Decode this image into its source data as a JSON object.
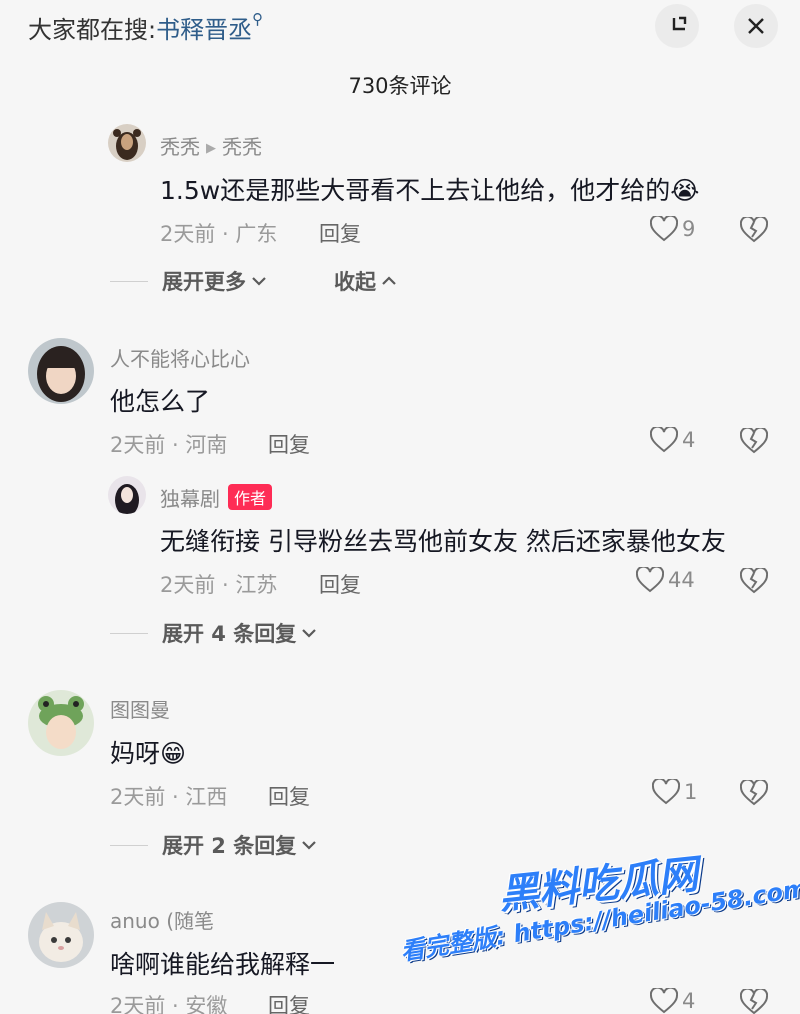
{
  "header": {
    "search_prefix": "大家都在搜:",
    "search_keyword": "书释晋丞",
    "count_title": "730条评论"
  },
  "comments": [
    {
      "reply_from": "秃秃",
      "reply_to": "秃秃",
      "text": "1.5w还是那些大哥看不上去让他给，他才给的😭",
      "time_location": "2天前 · 广东",
      "reply_label": "回复",
      "likes": "9",
      "expand_label": "展开更多",
      "collapse_label": "收起"
    },
    {
      "name": "人不能将心比心",
      "text": "他怎么了",
      "time_location": "2天前 · 河南",
      "reply_label": "回复",
      "likes": "4"
    },
    {
      "name": "独幕剧",
      "badge": "作者",
      "text": "无缝衔接 引导粉丝去骂他前女友 然后还家暴他女友",
      "time_location": "2天前 · 江苏",
      "reply_label": "回复",
      "likes": "44",
      "expand_label": "展开 4 条回复"
    },
    {
      "name": "图图曼",
      "text": "妈呀😁",
      "time_location": "2天前 · 江西",
      "reply_label": "回复",
      "likes": "1",
      "expand_label": "展开 2 条回复"
    },
    {
      "name": "anuo (随笔",
      "text": "啥啊谁能给我解释一",
      "time_location": "2天前 · 安徽",
      "reply_label": "回复",
      "likes": "4"
    }
  ],
  "watermark": {
    "logo": "黑料吃瓜网",
    "url": "看完整版: https://heiliao-58.com"
  },
  "colors": {
    "background": "#f6f6f6",
    "author_badge": "#fe2c55",
    "search_keyword": "#2f5d8a",
    "watermark": "#2d7ff9"
  },
  "icons": [
    "search-icon",
    "shrink-icon",
    "close-icon",
    "heart-icon",
    "broken-heart-icon",
    "chevron-down-icon",
    "chevron-up-icon"
  ]
}
